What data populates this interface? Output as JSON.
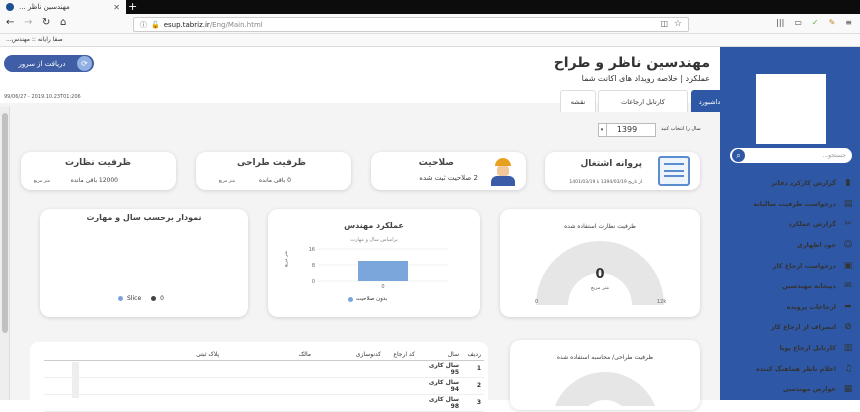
{
  "browser": {
    "tab_title": "مهندسین ناظر ...",
    "url_host": "esup.tabriz.ir",
    "url_path": "/Eng/Main.html",
    "bookmark": "صفا رایانه :: مهندس...",
    "new_tab": "+"
  },
  "sidebar": {
    "search_placeholder": "جستجو...",
    "items": [
      {
        "label": "گزارش کارکرد دفاتر",
        "icon": "chart-icon"
      },
      {
        "label": "درخواست ظرفیت سالیانه",
        "icon": "doc-icon"
      },
      {
        "label": "گزارش عملکرد",
        "icon": "tools-icon"
      },
      {
        "label": "خود اظهاری",
        "icon": "user-icon"
      },
      {
        "label": "درخواست ارجاع کار",
        "icon": "form-icon"
      },
      {
        "label": "دیپخانه مهندسین",
        "icon": "mail-icon"
      },
      {
        "label": "ارجاعات پرونده",
        "icon": "share-icon"
      },
      {
        "label": "انصراف از ارجاع کار",
        "icon": "ban-icon"
      },
      {
        "label": "کارتابل ارجاع پویا",
        "icon": "folder-icon"
      },
      {
        "label": "اعلام ناظر هماهنگ کننده",
        "icon": "bell-icon"
      },
      {
        "label": "عوارض مهندسی",
        "icon": "list-icon"
      }
    ]
  },
  "header": {
    "title": "مهندسین ناظر و طراح",
    "subtitle": "عملکرد | خلاصه رویداد های اکانت شما",
    "fetch_button": "دریافت از سرور",
    "timestamp": "99/06/27 - 2019.10.23T01:206"
  },
  "tabs": [
    {
      "label": "داشبورد",
      "active": true
    },
    {
      "label": "کارتابل ارجاعات",
      "active": false
    },
    {
      "label": "نقشه",
      "active": false
    }
  ],
  "year": {
    "label": "سال را انتخاب کنید",
    "value": "1399",
    "arrow": "▾"
  },
  "cards": {
    "license": {
      "title": "پروانه اشتغال",
      "line": "از تاریخ 1394/03/19  تا 1401/03/19"
    },
    "qualification": {
      "title": "صلاحیت",
      "value": "2 صلاحیت ثبت شده"
    },
    "design_capacity": {
      "title": "ظرفیت طراحی",
      "value": "0 باقی مانده",
      "sub": "متر مربع"
    },
    "supervision_capacity": {
      "title": "ظرفیت نظارت",
      "value": "12000 باقی مانده",
      "sub": "متر مربع"
    }
  },
  "gauge1": {
    "title": "ظرفیت نظارت استفاده شده",
    "value": "0",
    "unit": "متر مربع",
    "min": "0",
    "max": "12k"
  },
  "gauge2": {
    "title": "ظرفیت طراحی/ محاسبه استفاده شده"
  },
  "engineer_perf": {
    "title": "عملکرد مهندس",
    "subtitle": "براساس سال و مهارت",
    "ylabel": "متر مربع",
    "legend": "بدون صلاحیت"
  },
  "chart_data": [
    {
      "type": "bar",
      "title": "عملکرد مهندس",
      "subtitle": "براساس سال و مهارت",
      "categories": [
        "0"
      ],
      "series": [
        {
          "name": "بدون صلاحیت",
          "values": [
            10
          ]
        }
      ],
      "ylabel": "متر مربع",
      "ylim": [
        0,
        16
      ],
      "yticks": [
        "16",
        "8",
        "0"
      ],
      "legend": "bottom"
    },
    {
      "type": "pie",
      "title": "نمودار برحسب سال و مهارت",
      "labels": [
        "Slice",
        "0"
      ],
      "values": [
        0,
        0
      ]
    }
  ],
  "pie": {
    "title": "نمودار برحسب سال و مهارت",
    "legend": [
      "Slice",
      "0"
    ]
  },
  "table": {
    "headers": [
      "ردیف",
      "سال",
      "کد ارجاع",
      "کدنوسازی",
      "مالک",
      "پلاک ثبتی"
    ],
    "rows": [
      [
        "1",
        "سال کاری 95"
      ],
      [
        "2",
        "سال کاری 94"
      ],
      [
        "3",
        "سال کاری 98"
      ]
    ]
  }
}
